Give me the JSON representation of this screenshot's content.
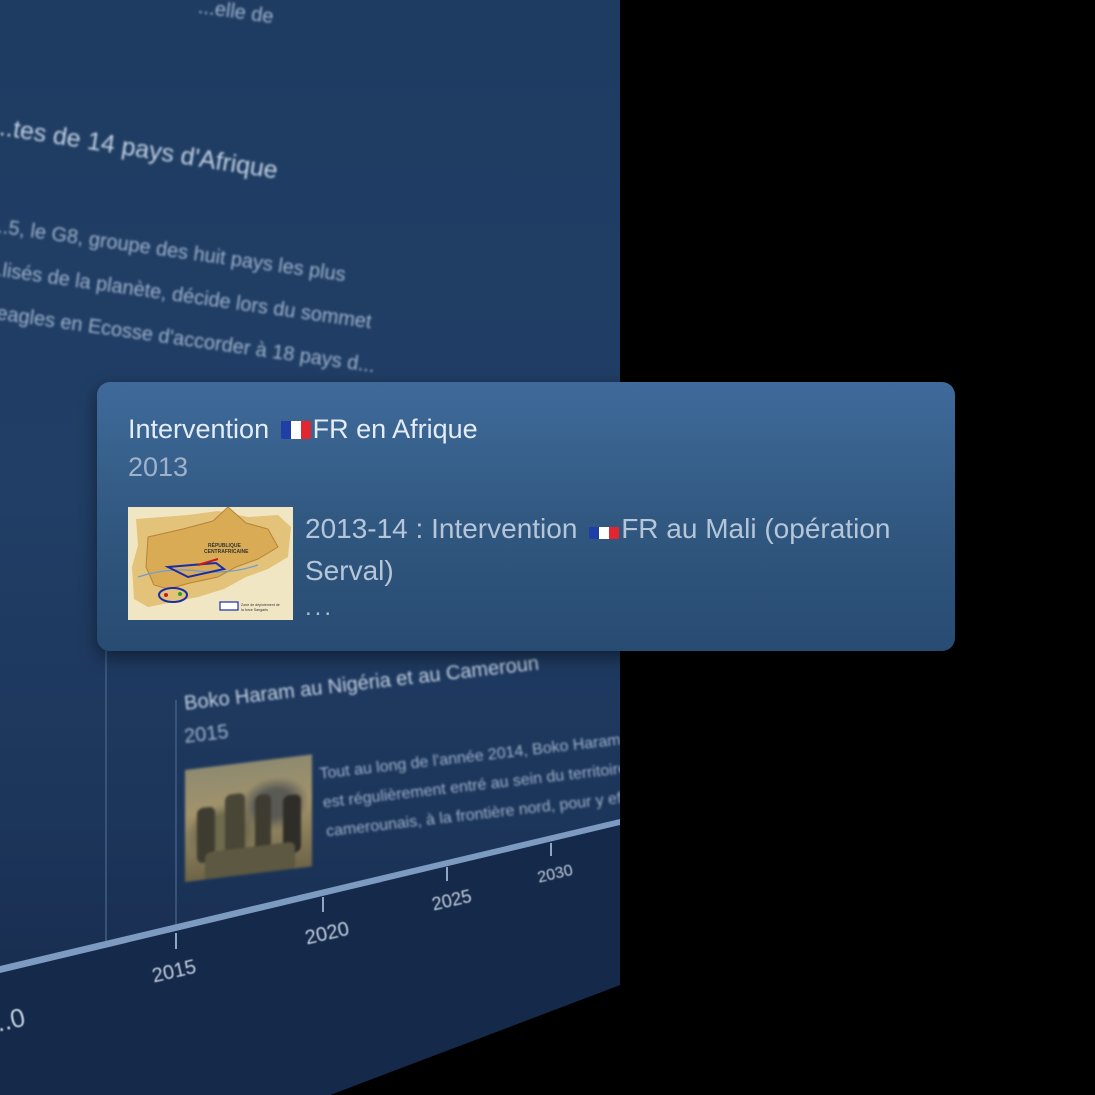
{
  "background_timeline": {
    "top_fragment": "...elle de",
    "event1": {
      "title": "...tes de 14 pays d'Afrique",
      "text_lines": [
        "...5, le G8, groupe des huit pays les plus",
        "...lisés de la planète, décide lors du sommet",
        "...eagles en Ecosse d'accorder à 18 pays d..."
      ]
    },
    "event2": {
      "title": "Boko Haram au Nigéria et au Cameroun",
      "year": "2015",
      "text_lines": [
        "Tout au long de l'année 2014, Boko Haram",
        "est régulièrement entré au sein du territoire",
        "camerounais, à la frontière nord, pour y effe..."
      ],
      "image_icon": "photo-soldiers"
    },
    "axis_ticks": [
      "...0",
      "2015",
      "2020",
      "2025",
      "2030"
    ]
  },
  "card": {
    "title_before_flag": "Intervention",
    "title_after_flag": "FR en Afrique",
    "year": "2013",
    "body_before_flag": "2013-14 : Intervention",
    "body_after_flag": "FR au Mali (opération Serval)",
    "more": "...",
    "flag_icon": "flag-france-icon",
    "flag_colors": [
      "#1f3fa6",
      "#ffffff",
      "#e1262f"
    ],
    "thumbnail": {
      "icon": "map-central-african-republic",
      "map_title_lines": [
        "RÉPUBLIQUE",
        "CENTRAFRICAINE"
      ],
      "legend_lines": [
        "Zone de déploiement de",
        "la force Sangaris"
      ]
    }
  },
  "colors": {
    "card_background": "#30577f",
    "panel_background": "#213e66",
    "axis_line": "#7d9ac0"
  }
}
